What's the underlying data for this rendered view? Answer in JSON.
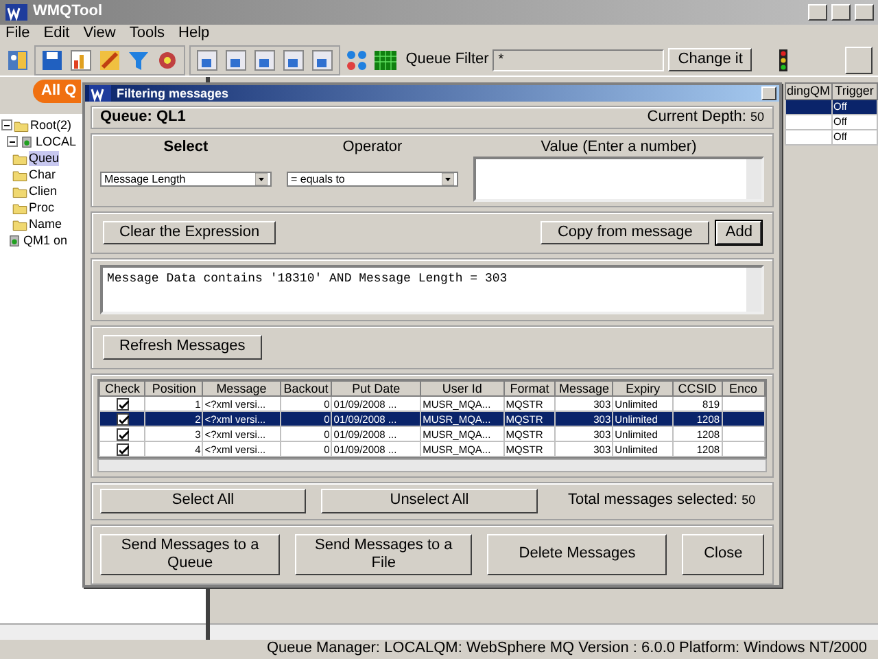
{
  "window": {
    "title": "WMQTool"
  },
  "menu": [
    "File",
    "Edit",
    "View",
    "Tools",
    "Help"
  ],
  "toolbar": {
    "queue_filter_label": "Queue Filter",
    "queue_filter_value": "*",
    "change_button": "Change it"
  },
  "tab": {
    "label": "All Q"
  },
  "tree": [
    {
      "label": "Root(2)",
      "expanded": true,
      "selected": false,
      "children": [
        {
          "label": "LOCAL",
          "expanded": true,
          "selected": false,
          "children": [
            {
              "label": "Queu",
              "selected": true
            },
            {
              "label": "Char",
              "selected": false
            },
            {
              "label": "Clien",
              "selected": false
            },
            {
              "label": "Proc",
              "selected": false
            },
            {
              "label": "Name",
              "selected": false
            }
          ]
        },
        {
          "label": "QM1 on",
          "selected": false
        }
      ]
    }
  ],
  "background_table": {
    "columns": [
      "dingQM",
      "Trigger"
    ],
    "rows": [
      {
        "trigger": "Off",
        "selected": true
      },
      {
        "trigger": "Off",
        "selected": false
      },
      {
        "trigger": "Off",
        "selected": false
      }
    ]
  },
  "dialog": {
    "title": "Filtering messages",
    "queue": "Queue: QL1",
    "depth_label": "Current Depth:",
    "depth": "50",
    "select_header": "Select",
    "operator_header": "Operator",
    "value_header": "Value (Enter a number)",
    "select_value": "Message Length",
    "operator_value": "= equals to",
    "clear_button": "Clear the Expression",
    "copy_button": "Copy from message",
    "add_button": "Add",
    "expression": "Message Data contains '18310' AND Message Length = 303",
    "refresh_button": "Refresh Messages",
    "columns": [
      "Check",
      "Position",
      "Message",
      "Backout",
      "Put Date",
      "User Id",
      "Format",
      "Message",
      "Expiry",
      "CCSID",
      "Enco"
    ],
    "rows": [
      {
        "checked": true,
        "selected": false,
        "cells": [
          "",
          "1",
          "<?xml versi...",
          "0",
          "01/09/2008 ...",
          "MUSR_MQA...",
          "MQSTR",
          "303",
          "Unlimited",
          "819",
          ""
        ]
      },
      {
        "checked": true,
        "selected": true,
        "cells": [
          "",
          "2",
          "<?xml versi...",
          "0",
          "01/09/2008 ...",
          "MUSR_MQA...",
          "MQSTR",
          "303",
          "Unlimited",
          "1208",
          ""
        ]
      },
      {
        "checked": true,
        "selected": false,
        "cells": [
          "",
          "3",
          "<?xml versi...",
          "0",
          "01/09/2008 ...",
          "MUSR_MQA...",
          "MQSTR",
          "303",
          "Unlimited",
          "1208",
          ""
        ]
      },
      {
        "checked": true,
        "selected": false,
        "cells": [
          "",
          "4",
          "<?xml versi...",
          "0",
          "01/09/2008 ...",
          "MUSR_MQA...",
          "MQSTR",
          "303",
          "Unlimited",
          "1208",
          ""
        ]
      }
    ],
    "select_all_button": "Select All",
    "unselect_all_button": "Unselect All",
    "total_label": "Total messages selected:",
    "total": "50",
    "buttons": [
      "Send Messages to a Queue",
      "Send Messages to a File",
      "Delete Messages",
      "Close"
    ]
  },
  "status_bar": "Queue Manager: LOCALQM: WebSphere MQ Version : 6.0.0 Platform: Windows NT/2000"
}
